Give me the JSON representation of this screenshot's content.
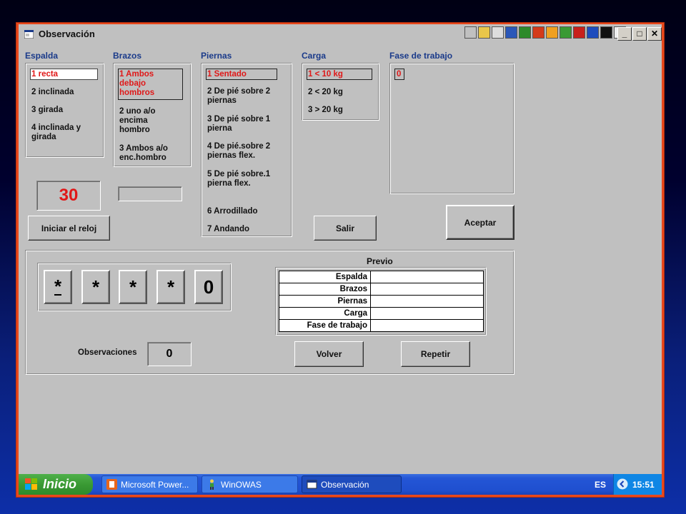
{
  "window": {
    "title": "Observación"
  },
  "titlebar_buttons": [
    "_",
    "□",
    "✕"
  ],
  "espalda": {
    "label": "Espalda",
    "options": [
      "1 recta",
      "2 inclinada",
      "3 girada",
      "4 inclinada y girada"
    ],
    "selected": 0
  },
  "brazos": {
    "label": "Brazos",
    "options": [
      "1 Ambos debajo hombros",
      "2 uno a/o encima hombro",
      "3 Ambos a/o enc.hombro"
    ],
    "selected": 0
  },
  "piernas": {
    "label": "Piernas",
    "options": [
      "1 Sentado",
      "2 De pié sobre 2 piernas",
      "3 De pié sobre 1 pierna",
      "4 De pié.sobre 2 piernas flex.",
      "5 De pié sobre.1 pierna flex.",
      "6 Arrodillado",
      "7 Andando"
    ],
    "selected": 0
  },
  "carga": {
    "label": "Carga",
    "options": [
      "1 < 10 kg",
      "2 < 20 kg",
      "3 > 20 kg"
    ],
    "selected": 0
  },
  "fase": {
    "label": "Fase de trabajo",
    "value": "0"
  },
  "timer": {
    "value": "30",
    "color": "#e01818"
  },
  "buttons": {
    "iniciar": "Iniciar el reloj",
    "salir": "Salir",
    "aceptar": "Aceptar",
    "volver": "Volver",
    "repetir": "Repetir"
  },
  "code_digits": [
    "*",
    "*",
    "*",
    "*",
    "0"
  ],
  "observaciones": {
    "label": "Observaciones",
    "value": "0"
  },
  "previo": {
    "title": "Previo",
    "rows": [
      {
        "key": "Espalda",
        "value": ""
      },
      {
        "key": "Brazos",
        "value": ""
      },
      {
        "key": "Piernas",
        "value": ""
      },
      {
        "key": "Carga",
        "value": ""
      },
      {
        "key": "Fase de trabajo",
        "value": ""
      }
    ]
  },
  "taskbar": {
    "start_label": "Inicio",
    "tasks": [
      "Microsoft Power...",
      "WinOWAS",
      "Observación"
    ],
    "language": "ES",
    "clock": "15:51"
  },
  "colors": {
    "accent_selected": "#e01818",
    "label_blue": "#1a3a8a",
    "frame": "#e8481c"
  }
}
